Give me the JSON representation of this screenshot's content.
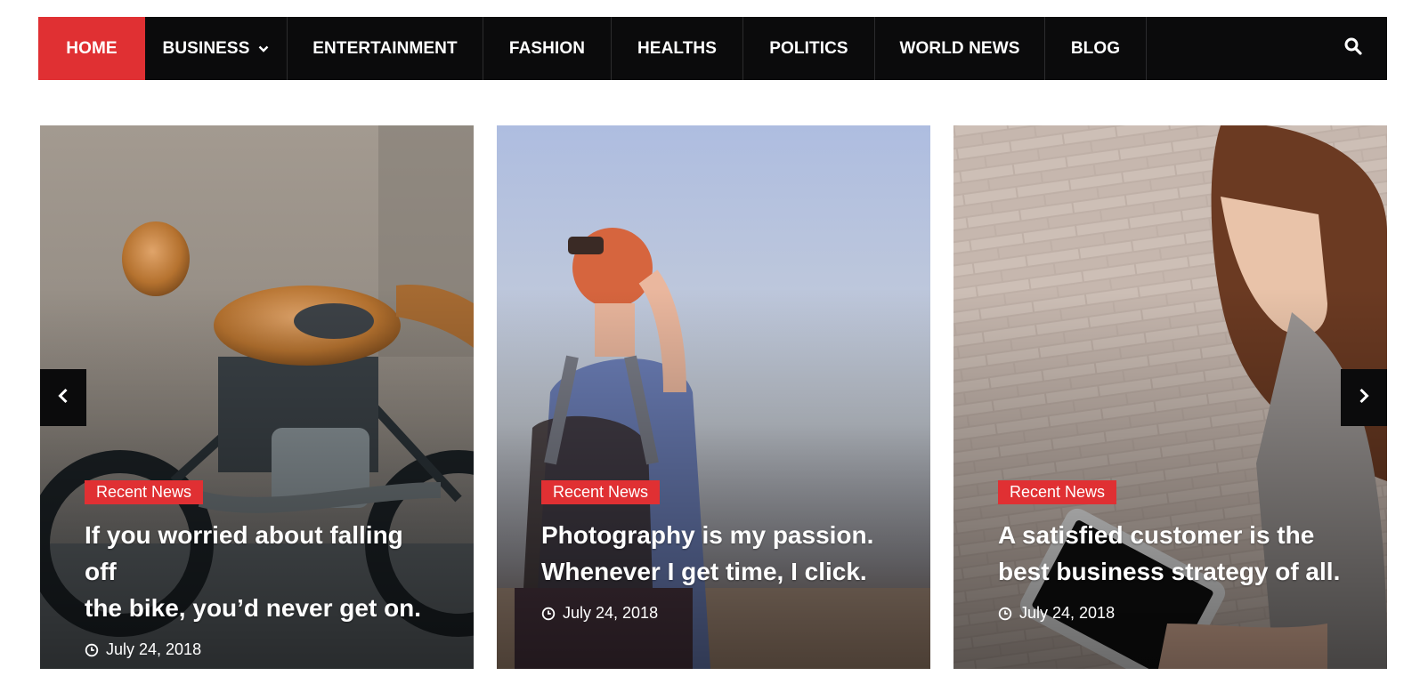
{
  "nav": {
    "items": [
      {
        "label": "HOME",
        "active": true
      },
      {
        "label": "BUSINESS",
        "has_dropdown": true
      },
      {
        "label": "ENTERTAINMENT"
      },
      {
        "label": "FASHION"
      },
      {
        "label": "HEALTHS"
      },
      {
        "label": "POLITICS"
      },
      {
        "label": "WORLD NEWS"
      },
      {
        "label": "BLOG"
      }
    ],
    "search_icon": "search-icon",
    "active_color": "#e03033",
    "bar_color": "#0b0b0c"
  },
  "slider": {
    "prev_icon": "chevron-left-icon",
    "next_icon": "chevron-right-icon",
    "cards": [
      {
        "badge": "Recent News",
        "title_line1": "If you worried about falling off",
        "title_line2": "the bike, you’d never get on.",
        "date": "July 24, 2018",
        "image": "motorcycle-photo"
      },
      {
        "badge": "Recent News",
        "title_line1": "Photography is my passion.",
        "title_line2": "Whenever I get time, I click.",
        "date": "July 24, 2018",
        "image": "woman-backpack-photo"
      },
      {
        "badge": "Recent News",
        "title_line1": "A satisfied customer is the",
        "title_line2": "best business strategy of all.",
        "date": "July 24, 2018",
        "image": "woman-tablet-photo"
      }
    ]
  }
}
